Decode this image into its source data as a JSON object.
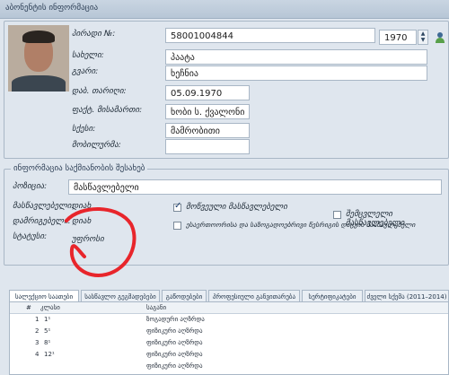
{
  "header": {
    "title": "აბონენტის ინფორმაცია"
  },
  "person": {
    "id_label": "პირადი №:",
    "id_value": "58001004844",
    "birth_year": "1970",
    "name_label": "სახელი:",
    "name_value": "პაატა",
    "surname_label": "გვარი:",
    "surname_value": "ხეჩნია",
    "dob_label": "დაბ. თარიღი:",
    "dob_value": "05.09.1970",
    "address_label": "ფაქტ. მისამართი:",
    "address_value": "ხობი ს. ქვალონი",
    "gender_label": "სქესი:",
    "gender_value": "მამრობითი",
    "phone_label": "მობილურმა:",
    "phone_value": ""
  },
  "status_section": {
    "title": "ინფორმაცია საქმიანობის შესახებ",
    "position_label": "პოზიცია:",
    "position_value": "მასწავლებელი",
    "teacher_label": "მასწავლებელი:",
    "teacher_value": "დიახ",
    "methodist_label": "დამრიგებელი:",
    "methodist_value": "დიახ",
    "staff_label": "სტატუსი:",
    "staff_value": "უფროსი",
    "cb1_label": "მოწვეული მასწავლებელი",
    "cb1_checked": true,
    "cb2_label": "შემცვლელი მასწავლებელი",
    "cb2_checked": false,
    "cb3_label": "ესაერთოორისა და საზოგადოებრივი წესრიგის დაცვის მასწავლებელი",
    "cb3_checked": false
  },
  "tabs": [
    "სალექციო საათები",
    "სასწავლო გეგმადებები",
    "გაწოდებები",
    "პროფესიული განვითარება",
    "სერტიფიკატები",
    "ძველი სქემა (2011–2014)"
  ],
  "table": {
    "columns": [
      "#",
      "კლასი",
      "საგანი"
    ],
    "rows": [
      {
        "num": "1",
        "cls": "1¹",
        "subject": "ზოგადური აღზრდა"
      },
      {
        "num": "2",
        "cls": "5¹",
        "subject": "ფიზიკური აღზრდა"
      },
      {
        "num": "3",
        "cls": "8¹",
        "subject": "ფიზიკური აღზრდა"
      },
      {
        "num": "4",
        "cls": "12¹",
        "subject": "ფიზიკური აღზრდა"
      },
      {
        "num": "",
        "cls": "",
        "subject": "ფიზიკური აღზრდა"
      }
    ]
  },
  "annotation": {
    "color": "#e8252b"
  }
}
